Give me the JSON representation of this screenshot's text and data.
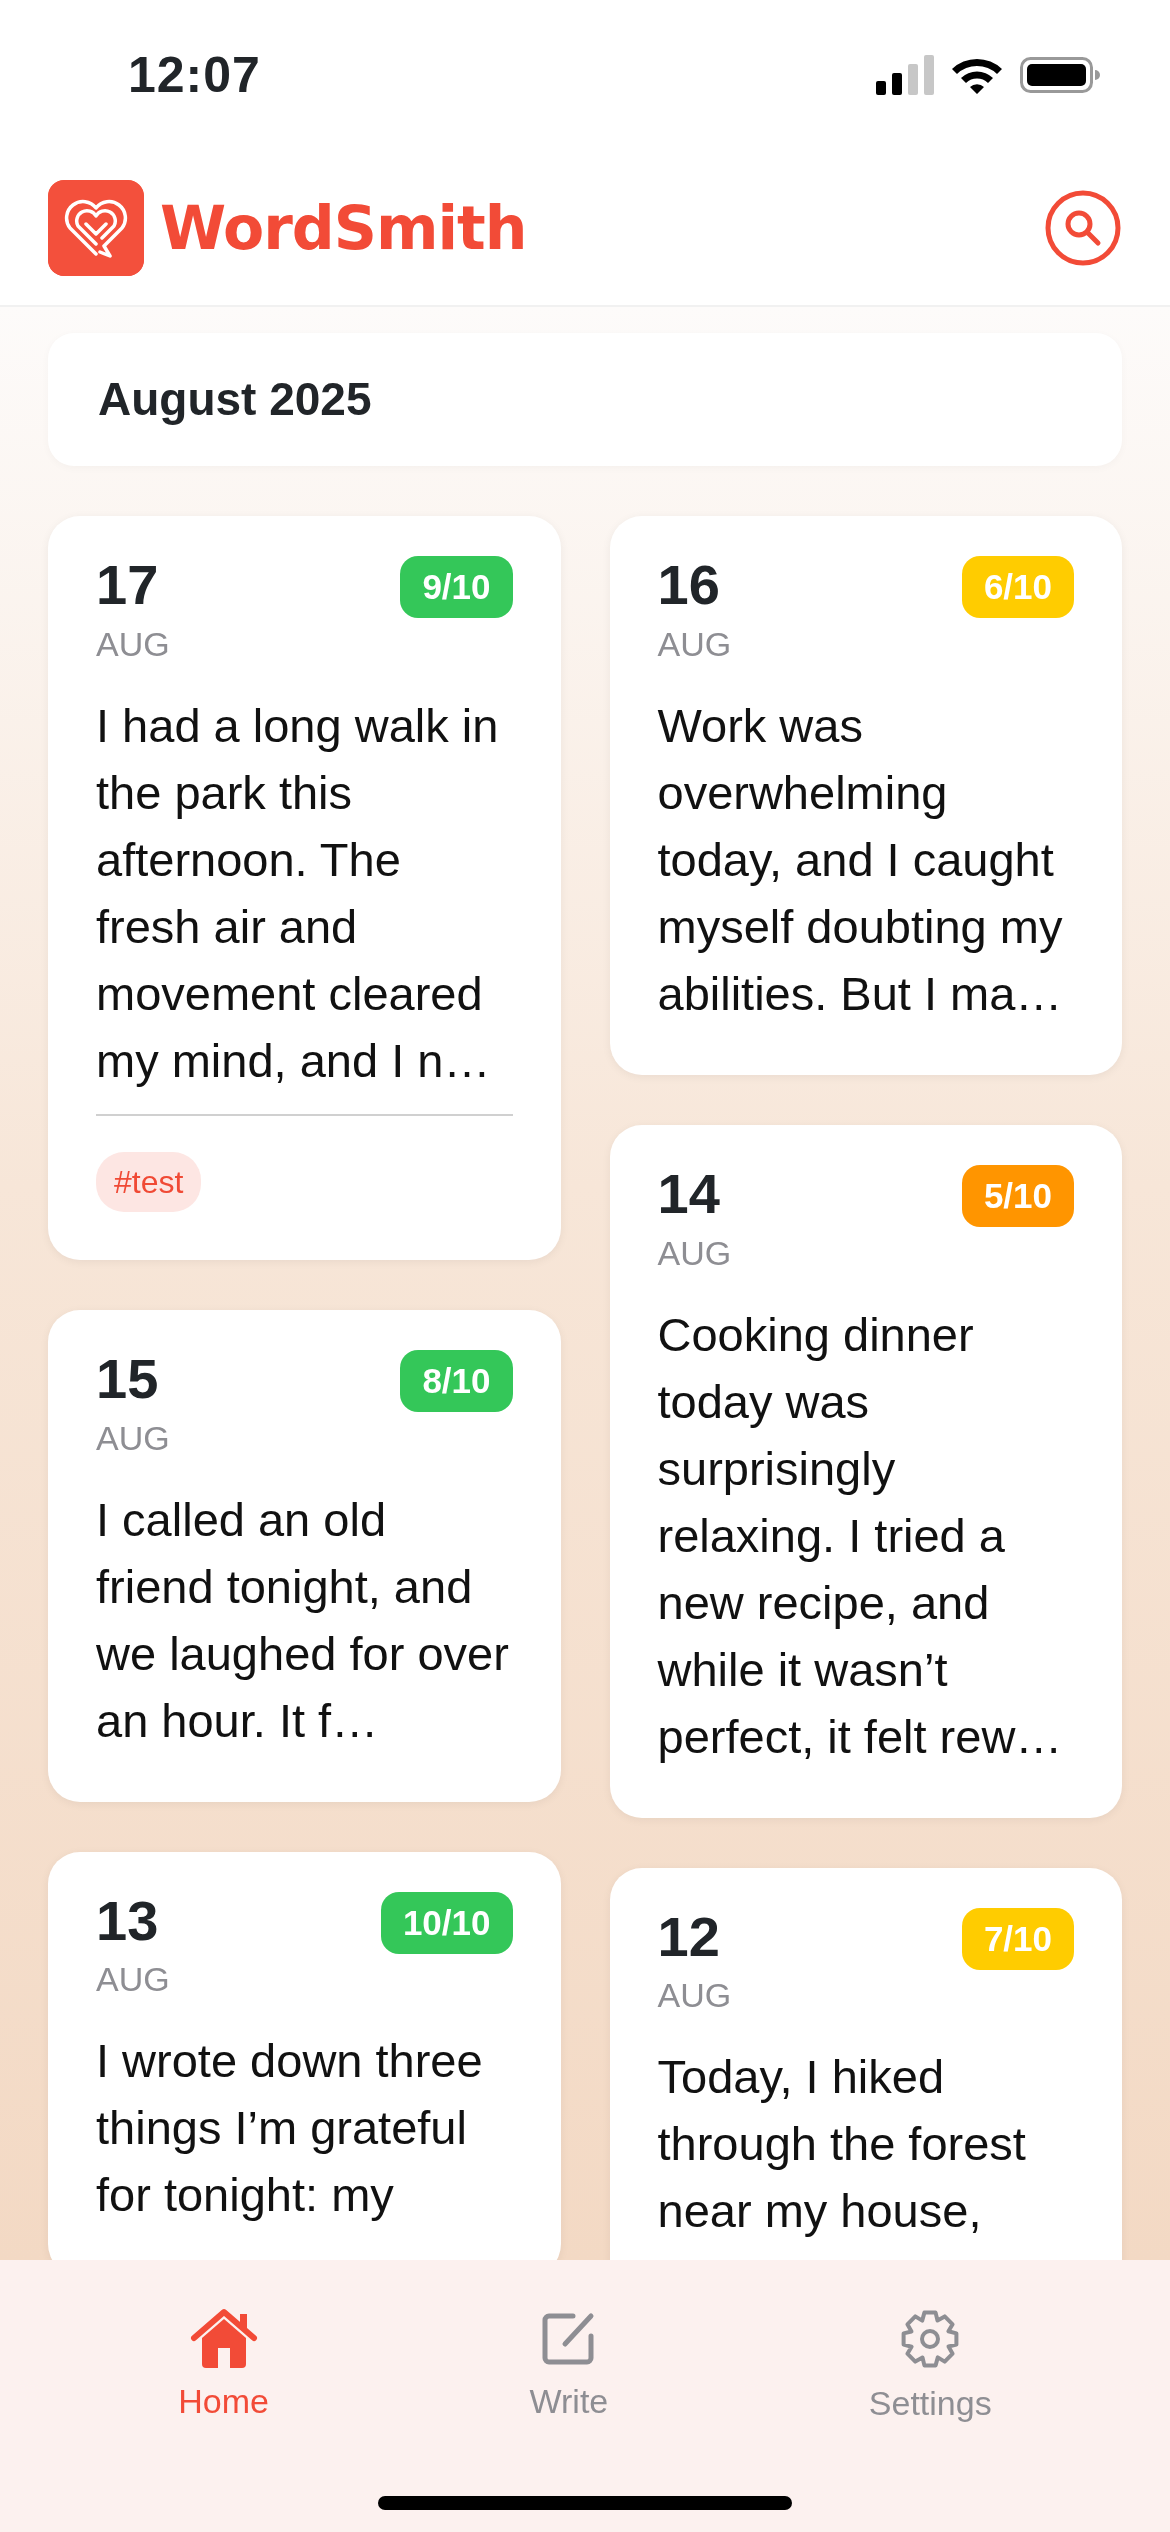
{
  "status_bar": {
    "time": "12:07"
  },
  "header": {
    "title": "WordSmith"
  },
  "month": {
    "label": "August 2025"
  },
  "columns": [
    {
      "entries": [
        {
          "day": "17",
          "month": "AUG",
          "score": "9/10",
          "color": "#34c759",
          "text": "I had a long walk in the park this afternoon. The fresh air and movement cleared my mind, and I n…",
          "tags": [
            "#test"
          ]
        },
        {
          "day": "15",
          "month": "AUG",
          "score": "8/10",
          "color": "#34c759",
          "text": "I called an old friend tonight, and we laughed for over an hour. It f…"
        },
        {
          "day": "13",
          "month": "AUG",
          "score": "10/10",
          "color": "#34c759",
          "text": "I wrote down three things I’m grateful for tonight: my"
        }
      ]
    },
    {
      "entries": [
        {
          "day": "16",
          "month": "AUG",
          "score": "6/10",
          "color": "#ffcc00",
          "text": "Work was overwhelming today, and I caught myself doubting my abilities. But I ma…"
        },
        {
          "day": "14",
          "month": "AUG",
          "score": "5/10",
          "color": "#ff9500",
          "text": "Cooking dinner today was surprisingly relaxing. I tried a new recipe, and while it wasn’t perfect, it felt rew…"
        },
        {
          "day": "12",
          "month": "AUG",
          "score": "7/10",
          "color": "#ffcc00",
          "text": "Today, I hiked through the forest near my house,"
        }
      ]
    }
  ],
  "tabs": [
    {
      "label": "Home",
      "selected": true
    },
    {
      "label": "Write",
      "selected": false
    },
    {
      "label": "Settings",
      "selected": false
    }
  ]
}
